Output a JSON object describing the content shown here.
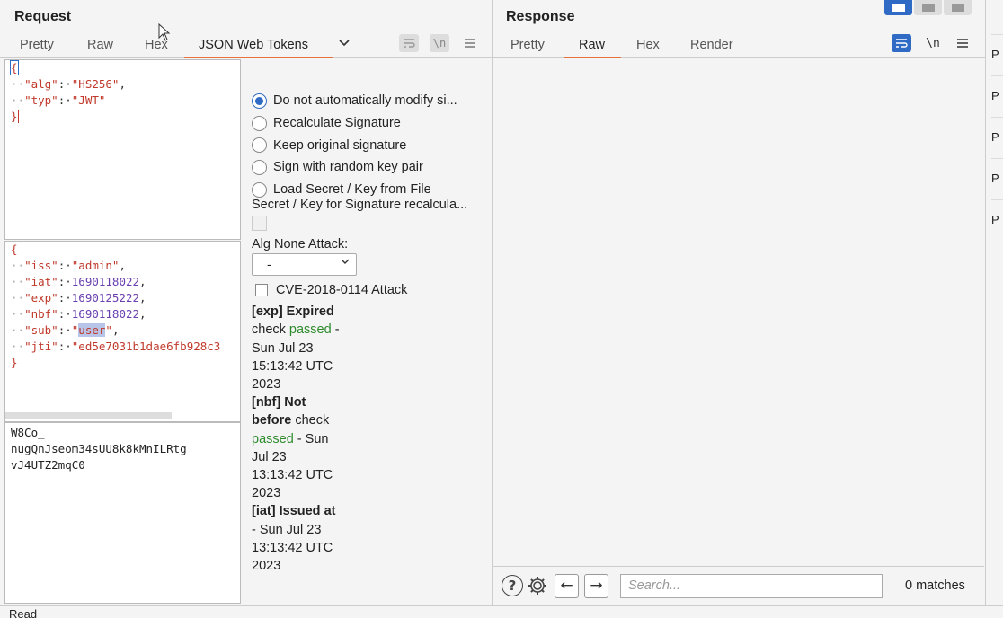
{
  "request": {
    "title": "Request",
    "tabs": [
      "Pretty",
      "Raw",
      "Hex",
      "JSON Web Tokens"
    ],
    "dropdown_icon": "chevron-down-icon",
    "tools": {
      "wrap": "wrap-icon",
      "newline": "\\n",
      "menu": "menu-icon"
    },
    "header_json": {
      "alg_key": "\"alg\"",
      "alg_val": "\"HS256\"",
      "typ_key": "\"typ\"",
      "typ_val": "\"JWT\""
    },
    "payload_json": {
      "iss_key": "\"iss\"",
      "iss_val": "\"admin\"",
      "iat_key": "\"iat\"",
      "iat_val": "1690118022",
      "exp_key": "\"exp\"",
      "exp_val": "1690125222",
      "nbf_key": "\"nbf\"",
      "nbf_val": "1690118022",
      "sub_key": "\"sub\"",
      "sub_val": "user",
      "jti_key": "\"jti\"",
      "jti_val": "\"ed5e7031b1dae6fb928c3"
    },
    "signature_lines": [
      "W8Co_",
      "nugQnJseom34sUU8k8kMnILRtg_",
      "vJ4UTZ2mqC0"
    ],
    "options": {
      "radios": [
        {
          "label": "Do not automatically modify si...",
          "checked": true
        },
        {
          "label": "Recalculate Signature",
          "checked": false
        },
        {
          "label": "Keep original signature",
          "checked": false
        },
        {
          "label": "Sign with random key pair",
          "checked": false
        },
        {
          "label": "Load Secret / Key from File",
          "checked": false
        }
      ],
      "secret_label": "Secret / Key for Signature recalcula...",
      "alg_none_label": "Alg None Attack:",
      "alg_none_value": "-",
      "cve_label": "CVE-2018-0114 Attack"
    },
    "claims": {
      "exp_title": "[exp] Expired",
      "exp_check": "check",
      "exp_passed": "passed",
      "exp_date": "Sun Jul 23",
      "exp_time": "15:13:42 UTC",
      "exp_year": "2023",
      "nbf_title": "[nbf] Not",
      "nbf_title2": "before",
      "nbf_check": "check",
      "nbf_passed": "passed",
      "nbf_date1": "Sun",
      "nbf_date2": "Jul 23",
      "nbf_time": "13:13:42 UTC",
      "nbf_year": "2023",
      "iat_title": "[iat] Issued at",
      "iat_date": "- Sun Jul 23",
      "iat_time": "13:13:42 UTC",
      "iat_year": "2023"
    }
  },
  "response": {
    "title": "Response",
    "tabs": [
      "Pretty",
      "Raw",
      "Hex",
      "Render"
    ],
    "active_tab": "Raw",
    "newline": "\\n",
    "search_placeholder": "Search...",
    "matches": "0 matches"
  },
  "side_strip": [
    "P",
    "P",
    "P",
    "P",
    "P"
  ],
  "status": "Read",
  "colors": {
    "accent": "#e8703a",
    "blue": "#2f6bc4",
    "string": "#c0392b",
    "number": "#6a3fb0",
    "passed": "#2e8b2e"
  }
}
